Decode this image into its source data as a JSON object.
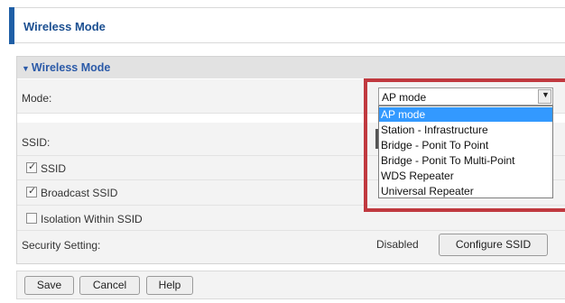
{
  "header": {
    "title": "Wireless Mode"
  },
  "section": {
    "title": "Wireless Mode"
  },
  "mode": {
    "label": "Mode:",
    "selected": "AP mode",
    "options": [
      "AP mode",
      "Station - Infrastructure",
      "Bridge - Ponit To Point",
      "Bridge - Ponit To Multi-Point",
      "WDS Repeater",
      "Universal Repeater"
    ]
  },
  "ssid": {
    "label": "SSID:"
  },
  "checkboxes": [
    {
      "label": "SSID",
      "checked": true
    },
    {
      "label": "Broadcast SSID",
      "checked": true
    },
    {
      "label": "Isolation Within SSID",
      "checked": false
    }
  ],
  "security": {
    "label": "Security Setting:",
    "status": "Disabled",
    "button": "Configure SSID"
  },
  "footer": {
    "save": "Save",
    "cancel": "Cancel",
    "help": "Help"
  },
  "colors": {
    "accent": "#1f5fa6",
    "highlight": "#c0393f",
    "option_selected": "#3399ff"
  }
}
